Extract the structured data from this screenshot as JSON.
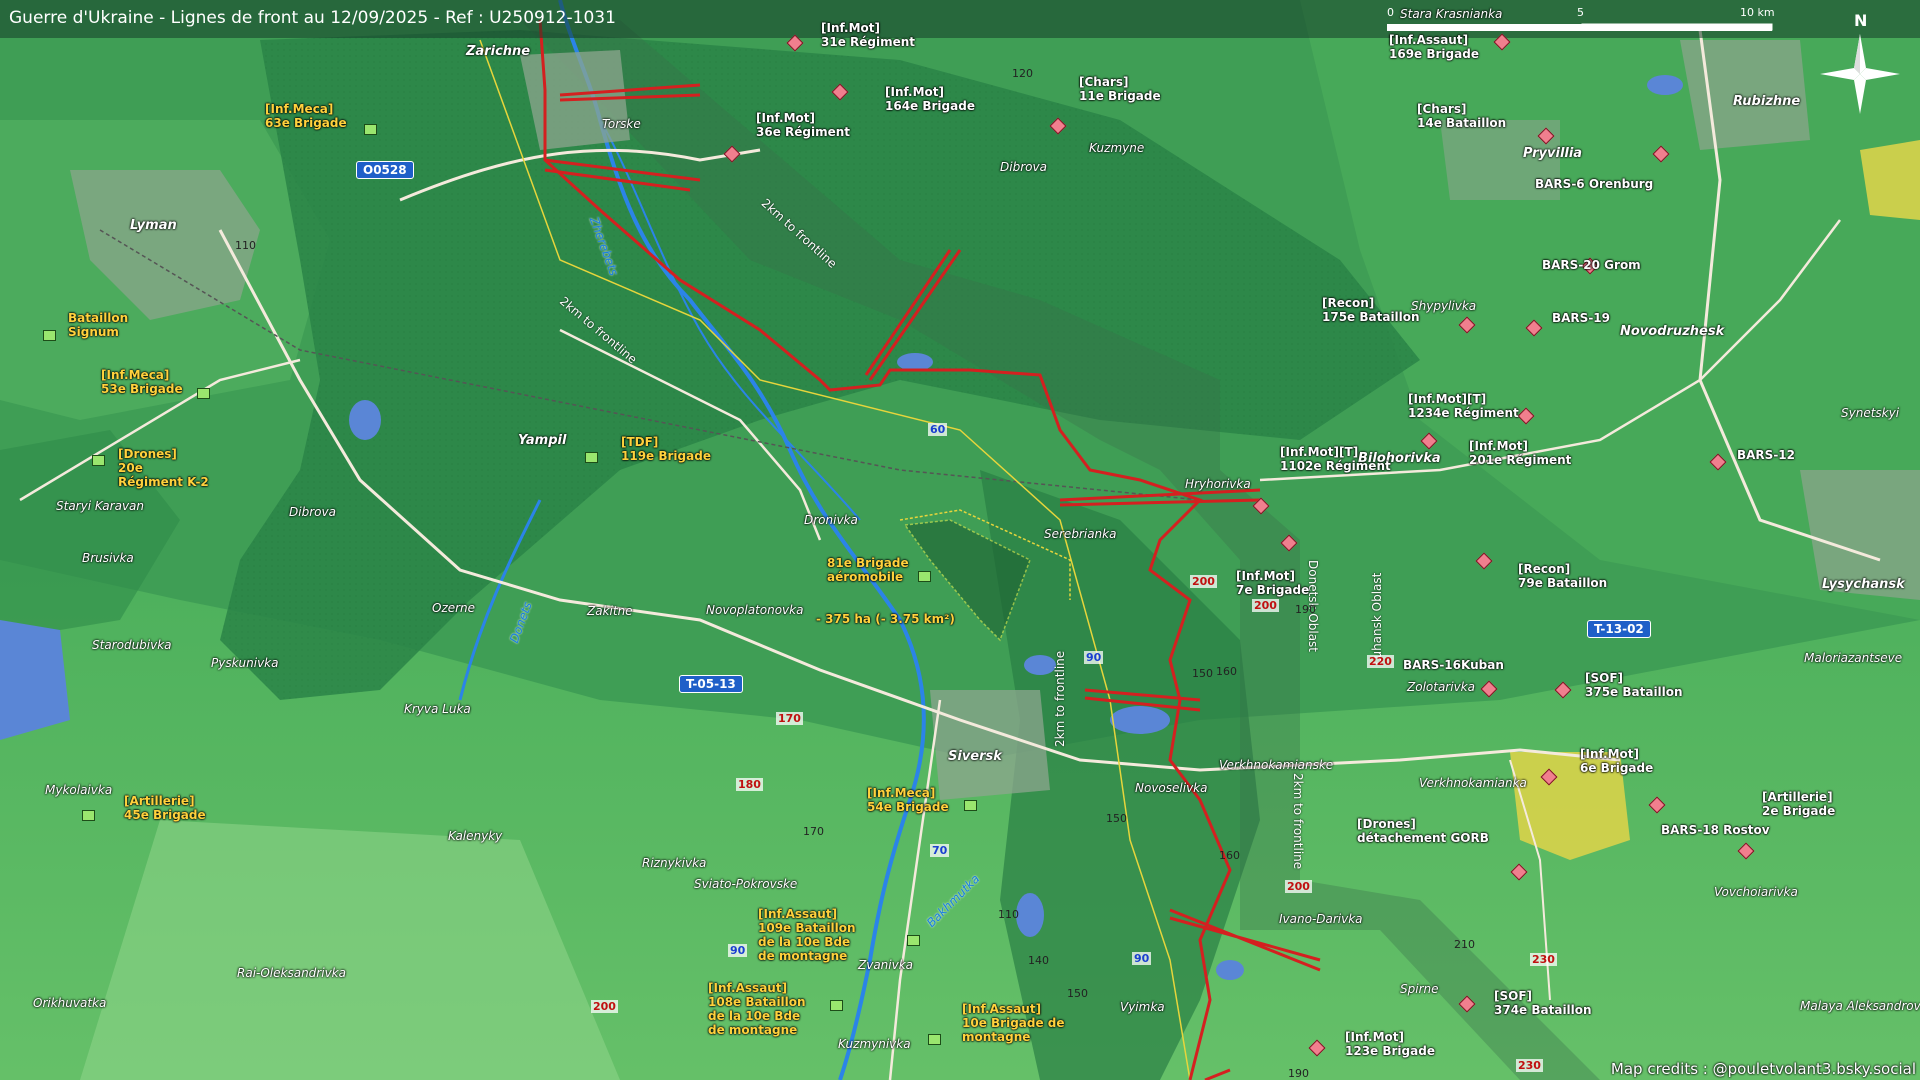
{
  "header": {
    "title": "Guerre d'Ukraine - Lignes de front au 12/09/2025 - Ref : U250912-1031"
  },
  "footer": {
    "credits": "Map credits : @pouletvolant3.bsky.social"
  },
  "scale": {
    "labels": [
      "0",
      "5",
      "10 km"
    ]
  },
  "compass": {
    "label": "N",
    "icon": "compass-rose-icon"
  },
  "colors": {
    "ua_unit_label": "#ffd23d",
    "ru_unit_marker": "#f07f8e",
    "ua_unit_marker": "#9ae66e",
    "frontline": "#d42020",
    "road_badge": "#1f5fc8",
    "forest": "#2f8f4c"
  },
  "towns": [
    "Zarichne",
    "Lyman",
    "Yampil",
    "Siversk",
    "Rubizhne",
    "Pryvillia",
    "Novodruzhesk",
    "Bilohorivka",
    "Lysychansk"
  ],
  "villages": [
    "Torske",
    "Dibrova",
    "Kuzmyne",
    "Staryi Karavan",
    "Dibrova",
    "Brusivka",
    "Ozerne",
    "Zakitne",
    "Novoplatonovka",
    "Dronivka",
    "Serebrianka",
    "Hryhorivka",
    "Shypylivka",
    "Starodubivka",
    "Pyskunivka",
    "Kryva Luka",
    "Mykolaivka",
    "Kalenyky",
    "Riznykivka",
    "Sviato-Pokrovske",
    "Zvanivka",
    "Rai-Oleksandrivka",
    "Orikhuvatka",
    "Kuzmynivka",
    "Novoselivka",
    "Verkhnokamianske",
    "Ivano-Darivka",
    "Vyimka",
    "Spirne",
    "Verkhnokamianka",
    "Zolotarivka",
    "Maloriazantseve",
    "Vovchoiarivka",
    "Malaya Aleksandrovka",
    "Synetskyi",
    "Stara Krasnianka"
  ],
  "rivers": [
    "Zherebets",
    "Donets",
    "Bakhmutka"
  ],
  "oblasts": [
    "Donetsk Oblast",
    "Luhansk Oblast"
  ],
  "frontline_notes": [
    "2km to frontline",
    "2km to frontline",
    "2km to frontline",
    "2km to frontline"
  ],
  "area_note": "- 375 ha (- 3.75 km²)",
  "roads": [
    "O0528",
    "T-05-13",
    "T-13-02"
  ],
  "elevations_black": [
    "120",
    "110",
    "190",
    "150",
    "160",
    "170",
    "150",
    "160",
    "110",
    "140",
    "150",
    "210",
    "190"
  ],
  "elevations_red": [
    "200",
    "170",
    "180",
    "200",
    "220",
    "200",
    "230",
    "230",
    "200"
  ],
  "elevations_blue": [
    "60",
    "90",
    "70",
    "90",
    "90"
  ],
  "ua_units": [
    "[Inf.Meca]\n63e Brigade",
    "[Inf.Meca]\n53e Brigade",
    "Bataillon\nSignum",
    "[Drones]\n20e\nRégiment K-2",
    "[TDF]\n119e Brigade",
    "81e Brigade\naéromobile",
    "[Inf.Meca]\n54e Brigade",
    "[Artillerie]\n45e Brigade",
    "[Inf.Assaut]\n109e Bataillon\nde la 10e Bde\nde montagne",
    "[Inf.Assaut]\n108e Bataillon\nde la 10e Bde\nde montagne",
    "[Inf.Assaut]\n10e Brigade de\nmontagne"
  ],
  "ru_units": [
    "[Inf.Mot]\n31e Régiment",
    "[Inf.Mot]\n164e Brigade",
    "[Inf.Mot]\n36e Régiment",
    "[Chars]\n11e Brigade",
    "[Inf.Assaut]\n169e Brigade",
    "[Chars]\n14e Bataillon",
    "BARS-6 Orenburg",
    "BARS-20 Grom",
    "BARS-19",
    "[Recon]\n175e Bataillon",
    "[Inf.Mot][T]\n1234e Régiment",
    "[Inf.Mot]\n201e Régiment",
    "[Inf.Mot][T]\n1102e Régiment",
    "BARS-12",
    "[Inf.Mot]\n7e Brigade",
    "[Recon]\n79e Bataillon",
    "BARS-16Kuban",
    "[SOF]\n375e Bataillon",
    "[Inf.Mot]\n6e Brigade",
    "[Artillerie]\n2e Brigade",
    "[Drones]\ndétachement GORB",
    "BARS-18 Rostov",
    "[SOF]\n374e Bataillon",
    "[Inf.Mot]\n123e Brigade"
  ]
}
